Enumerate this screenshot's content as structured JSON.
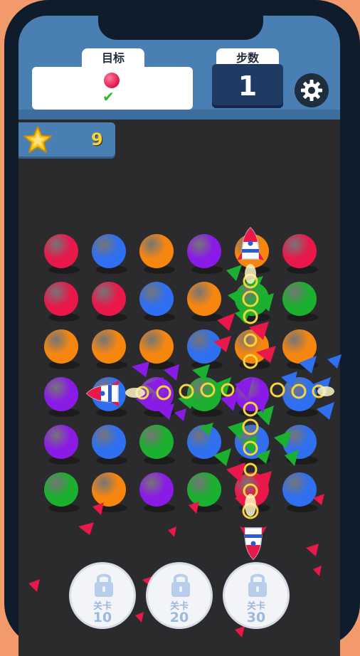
{
  "hud": {
    "goal_label": "目标",
    "steps_label": "步数",
    "steps_value": "1",
    "goal_target_color": "#e0124a",
    "goal_status": "✔",
    "star_count": "9"
  },
  "board": {
    "rows": [
      [
        "red",
        "blue",
        "orange",
        "purple",
        "orange",
        "red"
      ],
      [
        "red",
        "red",
        "blue",
        "orange",
        "green",
        "green"
      ],
      [
        "orange",
        "orange",
        "orange",
        "blue",
        "orange",
        "orange"
      ],
      [
        "purple",
        "blue",
        "purple",
        "green",
        "purple",
        "blue"
      ],
      [
        "purple",
        "blue",
        "green",
        "blue",
        "blue",
        "blue"
      ],
      [
        "green",
        "orange",
        "purple",
        "green",
        "red",
        "blue"
      ]
    ],
    "colors": {
      "red": "#e8184a",
      "blue": "#2f6ff0",
      "orange": "#f7860f",
      "purple": "#8a1be6",
      "green": "#1bb02f"
    }
  },
  "levels": [
    {
      "label": "关卡",
      "number": "10"
    },
    {
      "label": "关卡",
      "number": "20"
    },
    {
      "label": "关卡",
      "number": "30"
    }
  ]
}
